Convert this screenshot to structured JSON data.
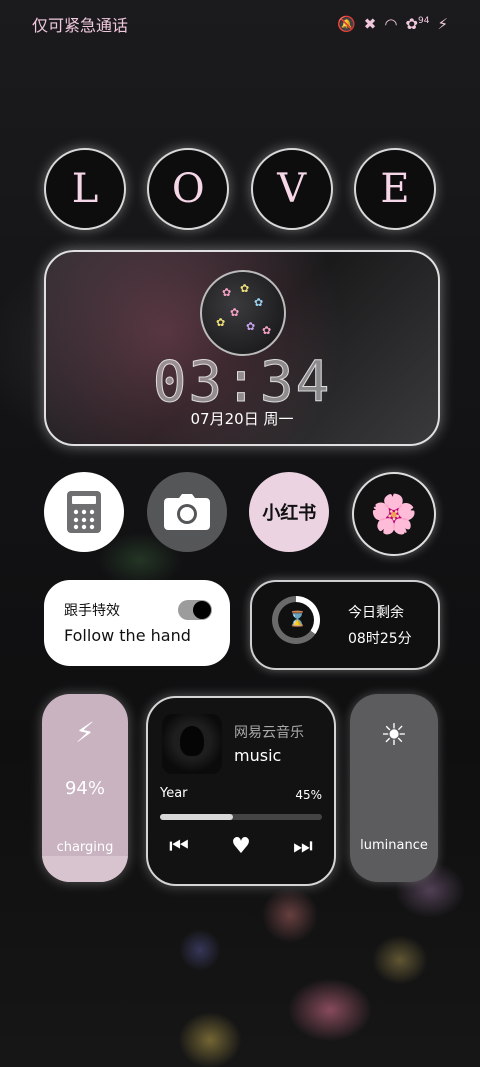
{
  "status_bar": {
    "carrier": "仅可紧急通话",
    "icons": [
      "bell-off-icon",
      "sim-x-icon",
      "wifi-icon",
      "battery-flower-icon",
      "charging-bolt-icon"
    ],
    "battery_badge": "94"
  },
  "love_letters": [
    "L",
    "O",
    "V",
    "E"
  ],
  "clock_widget": {
    "time": "03:34",
    "date": "07月20日  周一"
  },
  "app_row": {
    "calculator": "calculator-icon",
    "camera": "camera-icon",
    "xiaohongshu_label": "小红书",
    "flower": "flower-icon"
  },
  "follow_widget": {
    "title": "跟手特效",
    "subtitle": "Follow the hand",
    "toggle_on": true
  },
  "remaining_widget": {
    "title": "今日剩余",
    "value": "08时25分",
    "progress": 0.35
  },
  "battery_widget": {
    "percent_label": "94%",
    "percent": 94,
    "status": "charging",
    "color": "#d8c4cf"
  },
  "music_widget": {
    "app_name": "网易云音乐",
    "track": "music",
    "label": "Year",
    "percent_label": "45%",
    "progress": 0.45
  },
  "brightness_widget": {
    "label": "luminance"
  }
}
